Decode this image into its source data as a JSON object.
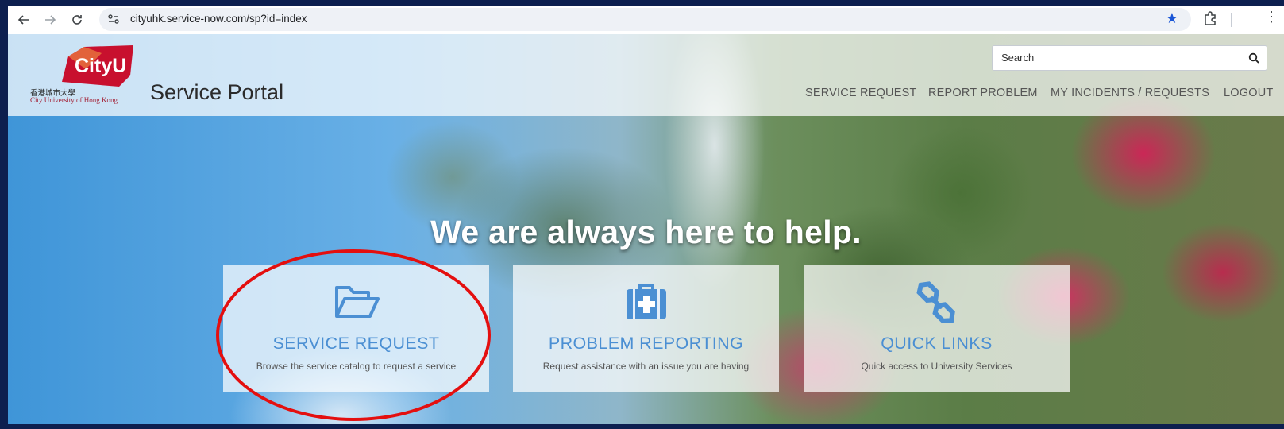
{
  "browser": {
    "url": "cityuhk.service-now.com/sp?id=index",
    "icons": [
      "back-icon",
      "forward-icon",
      "reload-icon",
      "site-settings-icon",
      "bookmark-star-icon",
      "extensions-icon",
      "menu-kebab-icon"
    ]
  },
  "header": {
    "logo_text": "CityU",
    "logo_chinese": "香港城市大學",
    "logo_english": "City University of Hong Kong",
    "portal_title": "Service Portal",
    "search_placeholder": "Search",
    "menu": [
      "SERVICE REQUEST",
      "REPORT PROBLEM",
      "MY INCIDENTS / REQUESTS",
      "LOGOUT"
    ]
  },
  "hero": {
    "title": "We are always here to help."
  },
  "cards": [
    {
      "title": "SERVICE REQUEST",
      "description": "Browse the service catalog to request a service",
      "icon": "folder-open-icon"
    },
    {
      "title": "PROBLEM REPORTING",
      "description": "Request assistance with an issue you are having",
      "icon": "medkit-icon"
    },
    {
      "title": "QUICK LINKS",
      "description": "Quick access to University Services",
      "icon": "link-icon"
    }
  ],
  "colors": {
    "accent": "#4b8fd3",
    "annotation_circle": "#e40f0f",
    "logo_red": "#c8102e",
    "bookmark_star": "#1a56d6"
  }
}
